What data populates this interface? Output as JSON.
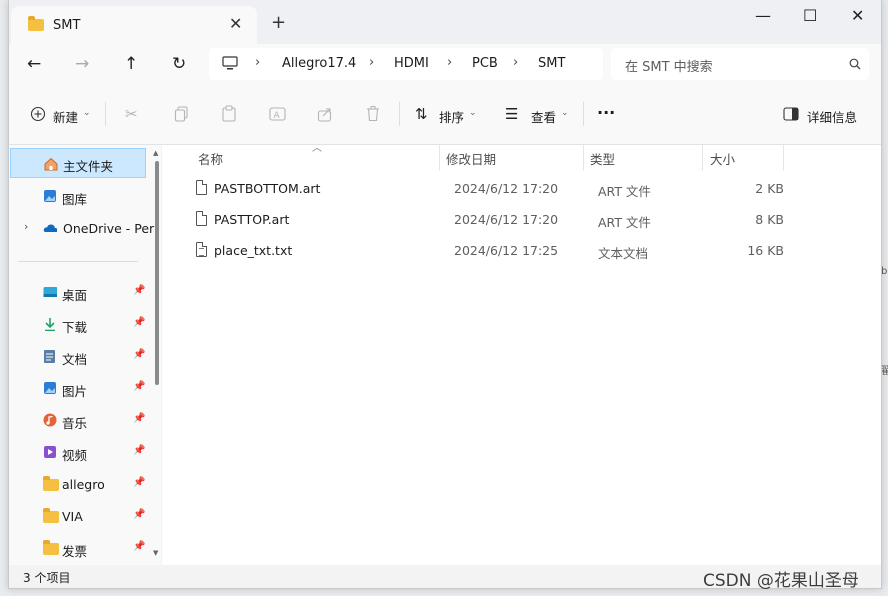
{
  "tab": {
    "title": "SMT",
    "close": "✕",
    "new_tab": "+"
  },
  "window_controls": {
    "minimize": "—",
    "maximize": "☐",
    "close": "✕"
  },
  "nav": {
    "back": "←",
    "forward": "→",
    "up": "↑",
    "refresh": "↻"
  },
  "breadcrumb": [
    "Allegro17.4",
    "HDMI",
    "PCB",
    "SMT"
  ],
  "breadcrumb_sep": "›",
  "search": {
    "placeholder": "在 SMT 中搜索"
  },
  "toolbar": {
    "new_label": "新建",
    "sort_label": "排序",
    "view_label": "查看",
    "more_label": "···",
    "details_label": "详细信息"
  },
  "sidebar": {
    "top_items": [
      {
        "label": "主文件夹",
        "icon": "home-icon",
        "selected": true
      },
      {
        "label": "图库",
        "icon": "gallery-icon"
      },
      {
        "label": "OneDrive - Per",
        "icon": "cloud-icon"
      }
    ],
    "quick_access": [
      {
        "label": "桌面",
        "icon": "desktop-icon"
      },
      {
        "label": "下载",
        "icon": "download-icon"
      },
      {
        "label": "文档",
        "icon": "document-icon"
      },
      {
        "label": "图片",
        "icon": "pictures-icon"
      },
      {
        "label": "音乐",
        "icon": "music-icon"
      },
      {
        "label": "视频",
        "icon": "video-icon"
      },
      {
        "label": "allegro",
        "icon": "folder-icon"
      },
      {
        "label": "VIA",
        "icon": "folder-icon"
      },
      {
        "label": "发票",
        "icon": "folder-icon"
      }
    ]
  },
  "columns": {
    "name": "名称",
    "date": "修改日期",
    "type": "类型",
    "size": "大小"
  },
  "files": [
    {
      "name": "PASTBOTTOM.art",
      "date": "2024/6/12 17:20",
      "type": "ART 文件",
      "size": "2 KB",
      "icon": "file-icon"
    },
    {
      "name": "PASTTOP.art",
      "date": "2024/6/12 17:20",
      "type": "ART 文件",
      "size": "8 KB",
      "icon": "file-icon"
    },
    {
      "name": "place_txt.txt",
      "date": "2024/6/12 17:25",
      "type": "文本文档",
      "size": "16 KB",
      "icon": "text-file-icon"
    }
  ],
  "status": {
    "count": "3 个项目"
  },
  "watermark": "CSDN @花果山圣母"
}
